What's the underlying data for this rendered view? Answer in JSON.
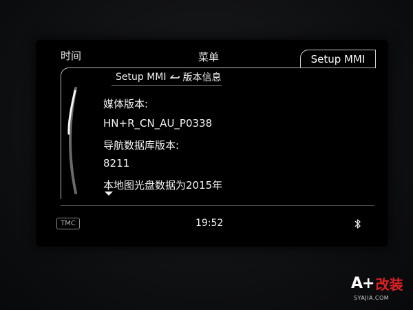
{
  "tabs": {
    "time": "时间",
    "menu": "菜单",
    "setup": "Setup MMI"
  },
  "breadcrumb": {
    "parent": "Setup MMI",
    "current": "版本信息"
  },
  "info": {
    "media_version_label": "媒体版本:",
    "media_version_value": "HN+R_CN_AU_P0338",
    "nav_db_label": "导航数据库版本:",
    "nav_db_value": "8211",
    "map_disc_text": "本地图光盘数据为2015年"
  },
  "status": {
    "tmc": "TMC",
    "time": "19:52"
  },
  "watermark": {
    "brand": "A+",
    "brand_cn": "改装",
    "url": "SYAJIA.COM"
  },
  "colors": {
    "screen_bg": "#000000",
    "text": "#f2f2f2",
    "frame": "#b9b9b9"
  },
  "icons": {
    "back": "back-arrow-icon",
    "scroll": "scroll-down-icon",
    "bluetooth": "bluetooth-icon"
  }
}
